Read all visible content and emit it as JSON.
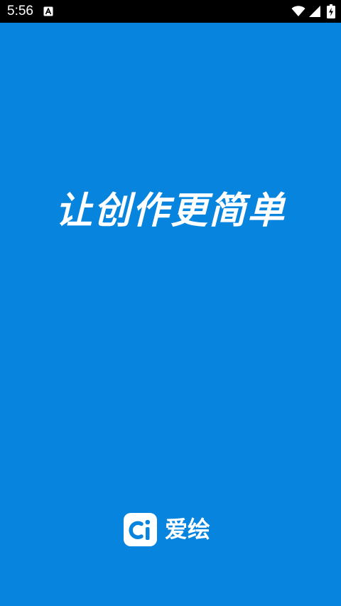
{
  "status_bar": {
    "time": "5:56",
    "notification_icon": "font-a-icon",
    "wifi_icon": "wifi-icon",
    "signal_icon": "cell-signal-icon",
    "battery_icon": "battery-charging-icon"
  },
  "splash": {
    "slogan": "让创作更简单",
    "background_color": "#0684de",
    "brand": {
      "logo_icon": "aihui-logo-icon",
      "name": "爱绘"
    }
  }
}
